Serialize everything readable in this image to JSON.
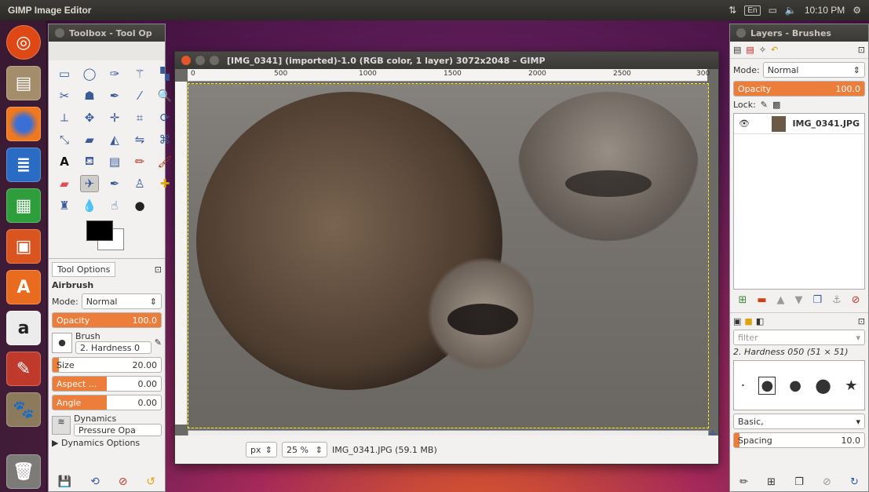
{
  "topbar": {
    "app_title": "GIMP Image Editor",
    "kb_layout": "En",
    "time": "10:10 PM",
    "icons": [
      "network-icon",
      "keyboard-layout",
      "battery-icon",
      "volume-icon",
      "settings-gear-icon"
    ]
  },
  "launcher": {
    "items": [
      "ubuntu-dash-icon",
      "files-icon",
      "firefox-icon",
      "writer-icon",
      "calc-icon",
      "impress-icon",
      "software-center-icon",
      "amazon-icon",
      "system-settings-icon",
      "gimp-icon",
      "trash-icon"
    ]
  },
  "toolbox": {
    "title": "Toolbox - Tool Op",
    "tool_options_tab": "Tool Options",
    "tool_name": "Airbrush",
    "mode_label": "Mode:",
    "mode_value": "Normal",
    "opacity_label": "Opacity",
    "opacity_value": "100.0",
    "brush_label": "Brush",
    "brush_value": "2. Hardness 0",
    "size_label": "Size",
    "size_value": "20.00",
    "aspect_label": "Aspect ...",
    "aspect_value": "0.00",
    "angle_label": "Angle",
    "angle_value": "0.00",
    "dynamics_label": "Dynamics",
    "dynamics_value": "Pressure Opa",
    "dynamics_options": "Dynamics Options",
    "fg_color": "#000000",
    "bg_color": "#ffffff"
  },
  "canvas": {
    "title": "[IMG_0341] (imported)-1.0 (RGB color, 1 layer) 3072x2048 – GIMP",
    "ruler_labels": [
      "0",
      "500",
      "1000",
      "1500",
      "2000",
      "2500",
      "300"
    ],
    "unit": "px",
    "zoom": "25 %",
    "status": "IMG_0341.JPG (59.1 MB)"
  },
  "layers": {
    "title": "Layers - Brushes",
    "mode_label": "Mode:",
    "mode_value": "Normal",
    "opacity_label": "Opacity",
    "opacity_value": "100.0",
    "lock_label": "Lock:",
    "layer_name": "IMG_0341.JPG",
    "filter_placeholder": "filter",
    "brush_name": "2. Hardness 050 (51 × 51)",
    "brush_set": "Basic,",
    "spacing_label": "Spacing",
    "spacing_value": "10.0"
  }
}
